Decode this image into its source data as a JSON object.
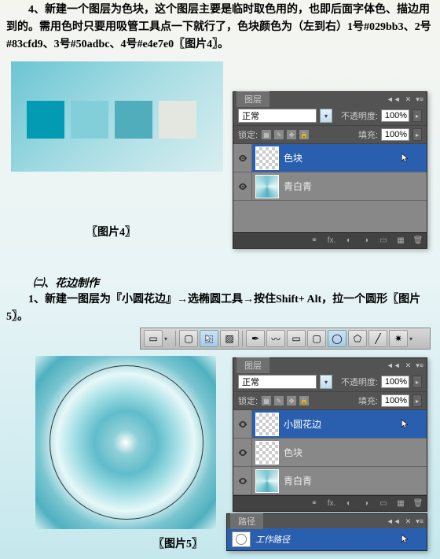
{
  "paragraphs": {
    "p1": "4、新建一个图层为色块，这个图层主要是临时取色用的，也即后面字体色、描边用到的。需用色时只要用吸管工具点一下就行了，色块颜色为（左到右）1号#029bb3、2号#83cfd9、3号#50adbc、4号#e4e7e0〖图片4〗。",
    "section": "㈡、花边制作",
    "p2": "1、新建一图层为『小圆花边』→选椭圆工具→按住Shift+ Alt，拉一个圆形〖图片5〗。"
  },
  "swatches": [
    "#029bb3",
    "#83cfd9",
    "#50adbc",
    "#e4e7e0"
  ],
  "labels": {
    "img4": "〖图片4〗",
    "img5": "〖图片5〗"
  },
  "panel": {
    "tab_layers": "图层",
    "tab_paths": "路径",
    "blend": "正常",
    "opacity_label": "不透明度:",
    "opacity_val": "100%",
    "lock_label": "锁定:",
    "fill_label": "填充:",
    "fill_val": "100%",
    "fx": "fx."
  },
  "layers1": {
    "l1": "色块",
    "l2": "青白青"
  },
  "layers2": {
    "l1": "小圆花边",
    "l2": "色块",
    "l3": "青白青"
  },
  "path": {
    "name": "工作路径"
  }
}
